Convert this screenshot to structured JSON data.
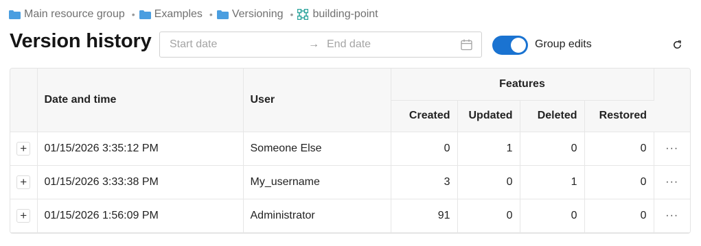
{
  "breadcrumb": [
    {
      "label": "Main resource group",
      "icon": "folder-icon"
    },
    {
      "label": "Examples",
      "icon": "folder-icon"
    },
    {
      "label": "Versioning",
      "icon": "folder-icon"
    },
    {
      "label": "building-point",
      "icon": "vector-layer-icon"
    }
  ],
  "page": {
    "title": "Version history"
  },
  "date_range": {
    "start_placeholder": "Start date",
    "end_placeholder": "End date",
    "arrow": "→"
  },
  "group_edits": {
    "label": "Group edits",
    "enabled": true
  },
  "table": {
    "headers": {
      "datetime": "Date and time",
      "user": "User",
      "features": "Features",
      "created": "Created",
      "updated": "Updated",
      "deleted": "Deleted",
      "restored": "Restored"
    },
    "rows": [
      {
        "expand": "+",
        "datetime": "01/15/2026 3:35:12 PM",
        "user": "Someone Else",
        "created": "0",
        "updated": "1",
        "deleted": "0",
        "restored": "0",
        "more": "···"
      },
      {
        "expand": "+",
        "datetime": "01/15/2026 3:33:38 PM",
        "user": "My_username",
        "created": "3",
        "updated": "0",
        "deleted": "1",
        "restored": "0",
        "more": "···"
      },
      {
        "expand": "+",
        "datetime": "01/15/2026 1:56:09 PM",
        "user": "Administrator",
        "created": "91",
        "updated": "0",
        "deleted": "0",
        "restored": "0",
        "more": "···"
      }
    ]
  },
  "colors": {
    "accent": "#1a73d1",
    "folder": "#4a9ee0",
    "layer": "#2aa39b"
  }
}
